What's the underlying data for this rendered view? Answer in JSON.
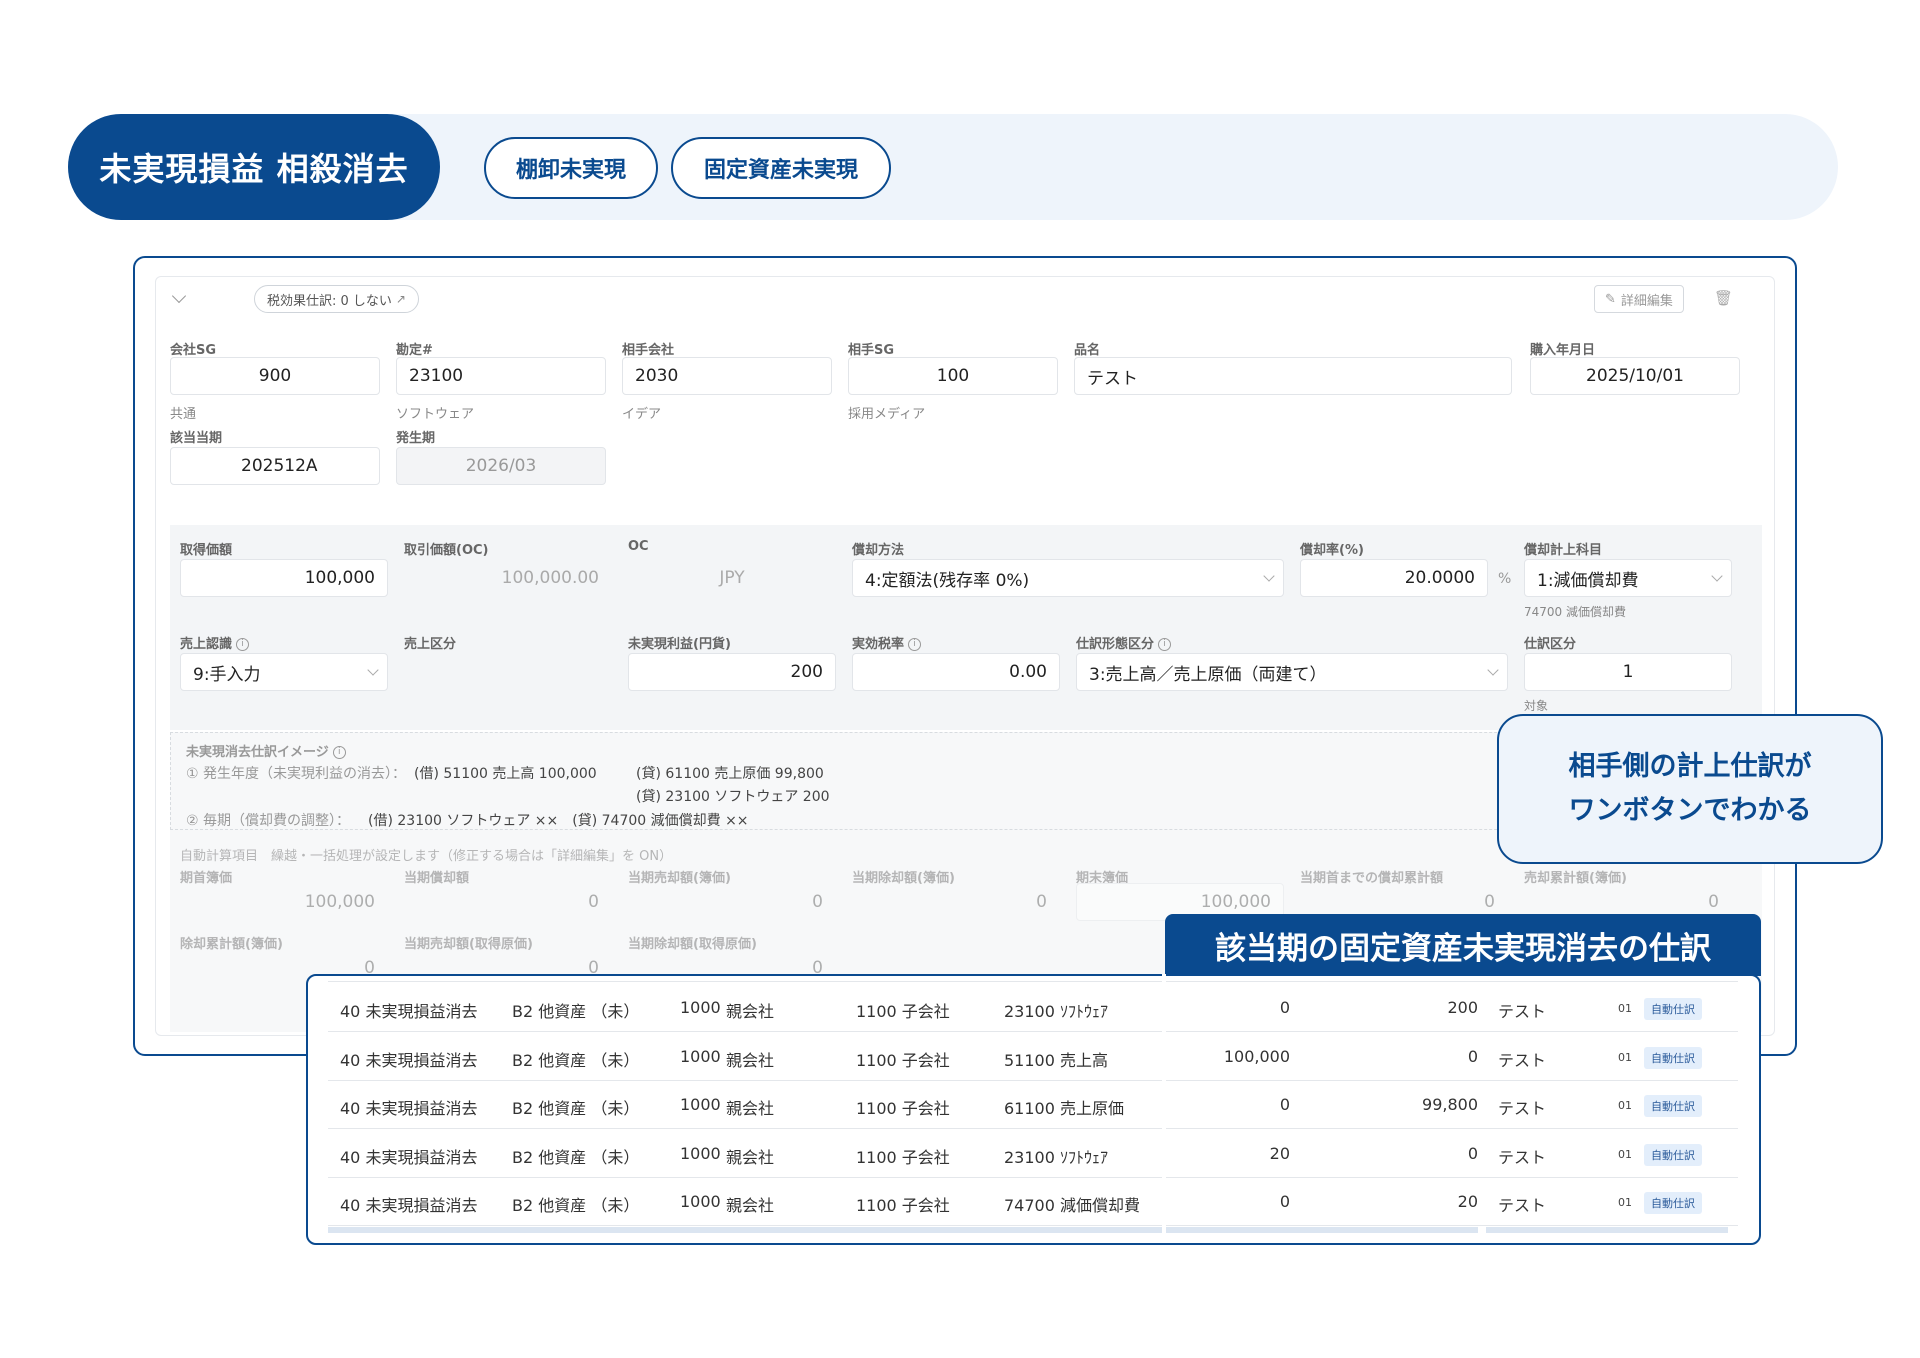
{
  "header": {
    "title": "未実現損益 相殺消去",
    "tabs": [
      "棚卸未実現",
      "固定資産未実現"
    ]
  },
  "form": {
    "tax_tag": "税効果仕訳: 0 しない",
    "edit_button": "詳細編集",
    "row1": [
      {
        "label": "会社SG",
        "value": "900",
        "sub": "共通"
      },
      {
        "label": "勘定#",
        "value": "23100",
        "sub": "ソフトウェア"
      },
      {
        "label": "相手会社",
        "value": "2030",
        "sub": "イデア"
      },
      {
        "label": "相手SG",
        "value": "100",
        "sub": "採用メディア"
      },
      {
        "label": "品名",
        "value": "テスト",
        "sub": ""
      },
      {
        "label": "購入年月日",
        "value": "2025/10/01",
        "sub": ""
      }
    ],
    "row2": [
      {
        "label": "該当当期",
        "value": "202512A"
      },
      {
        "label": "発生期",
        "value": "2026/03"
      }
    ],
    "row3": [
      {
        "label": "取得価額",
        "value": "100,000"
      },
      {
        "label": "取引価額(OC)",
        "value": "100,000.00"
      },
      {
        "label": "OC",
        "value": "JPY"
      },
      {
        "label": "償却方法",
        "value": "4:定額法(残存率 0%)"
      },
      {
        "label": "償却率(%)",
        "value": "20.0000",
        "unit": "%"
      },
      {
        "label": "償却計上科目",
        "value": "1:減価償却費",
        "sub": "74700 減価償却費"
      }
    ],
    "row4": [
      {
        "label": "売上認識",
        "value": "9:手入力"
      },
      {
        "label": "売上区分",
        "value": ""
      },
      {
        "label": "未実現利益(円貨)",
        "value": "200"
      },
      {
        "label": "実効税率",
        "value": "0.00"
      },
      {
        "label": "仕訳形態区分",
        "value": "3:売上高／売上原価（両建て）"
      },
      {
        "label": "仕訳区分",
        "value": "1",
        "sub": "対象"
      }
    ],
    "image": {
      "title": "未実現消去仕訳イメージ",
      "line1_label": "① 発生年度（未実現利益の消去）：",
      "line1_debit": "(借) 51100 売上高 100,000",
      "line1_credit": "(貸) 61100 売上原価 99,800",
      "line1_credit2": "(貸) 23100 ソフトウェア 200",
      "line2_label": "② 毎期（償却費の調整）：",
      "line2_text": "(借) 23100 ソフトウェア ××　(貸) 74700 減価償却費 ××"
    },
    "auto": {
      "title": "自動計算項目　繰越・一括処理が設定します（修正する場合は「詳細編集」を ON）",
      "row1": [
        {
          "label": "期首簿価",
          "value": "100,000"
        },
        {
          "label": "当期償却額",
          "value": "0"
        },
        {
          "label": "当期売却額(簿価)",
          "value": "0"
        },
        {
          "label": "当期除却額(簿価)",
          "value": "0"
        },
        {
          "label": "期末簿価",
          "value": "100,000"
        },
        {
          "label": "当期首までの償却累計額",
          "value": "0"
        },
        {
          "label": "売却累計額(簿価)",
          "value": "0"
        }
      ],
      "row2": [
        {
          "label": "除却累計額(簿価)",
          "value": "0"
        },
        {
          "label": "当期売却額(取得原価)",
          "value": "0"
        },
        {
          "label": "当期除却額(取得原価)",
          "value": "0"
        }
      ]
    }
  },
  "callout": {
    "line1": "相手側の計上仕訳が",
    "line2": "ワンボタンでわかる"
  },
  "journal": {
    "title": "該当期の固定資産未実現消去の仕訳",
    "rows": [
      [
        "40 未実現損益消去",
        "B2 他資産 （未）",
        "1000 ",
        "親会社",
        "1100 子会社",
        "23100 ｿﾌﾄｳｪｱ",
        "0",
        "200",
        "テスト",
        "01",
        "自動仕訳"
      ],
      [
        "40 未実現損益消去",
        "B2 他資産 （未）",
        "1000 ",
        "親会社",
        "1100 子会社",
        "51100 売上高",
        "100,000",
        "0",
        "テスト",
        "01",
        "自動仕訳"
      ],
      [
        "40 未実現損益消去",
        "B2 他資産 （未）",
        "1000 ",
        "親会社",
        "1100 子会社",
        "61100 売上原価",
        "0",
        "99,800",
        "テスト",
        "01",
        "自動仕訳"
      ],
      [
        "40 未実現損益消去",
        "B2 他資産 （未）",
        "1000 ",
        "親会社",
        "1100 子会社",
        "23100 ｿﾌﾄｳｪｱ",
        "20",
        "0",
        "テスト",
        "01",
        "自動仕訳"
      ],
      [
        "40 未実現損益消去",
        "B2 他資産 （未）",
        "1000 ",
        "親会社",
        "1100 子会社",
        "74700 減価償却費",
        "0",
        "20",
        "テスト",
        "01",
        "自動仕訳"
      ]
    ]
  }
}
